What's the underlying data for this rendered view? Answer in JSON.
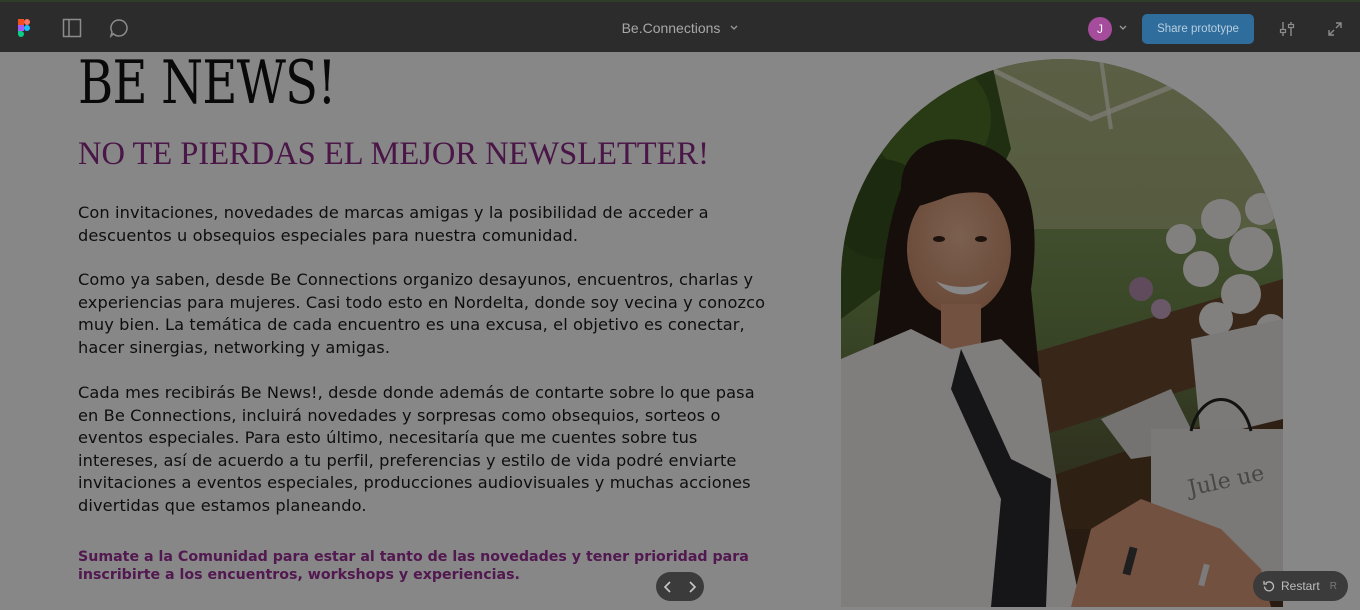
{
  "toolbar": {
    "logo_icon": "figma-logo-icon",
    "sidebar_icon": "sidebar-toggle-icon",
    "comment_icon": "comment-icon",
    "file_title": "Be.Connections",
    "avatar_initial": "J",
    "share_label": "Share prototype",
    "settings_icon": "settings-sliders-icon",
    "expand_icon": "expand-icon"
  },
  "page": {
    "headline": "BE NEWS!",
    "subheadline": "NO TE PIERDAS EL MEJOR NEWSLETTER!",
    "paragraph_1": "Con invitaciones, novedades de marcas amigas y la posibilidad de acceder a descuentos u obsequios especiales para nuestra comunidad.",
    "paragraph_2": "Como ya saben, desde Be Connections organizo desayunos, encuentros, charlas y experiencias para mujeres. Casi todo esto en Nordelta, donde soy vecina y conozco muy bien. La temática de cada encuentro es una excusa, el objetivo es conectar, hacer sinergias, networking y amigas.",
    "paragraph_3": "Cada mes recibirás Be News!, desde donde además de contarte sobre lo que pasa en Be Connections, incluirá novedades y sorpresas como obsequios, sorteos o eventos especiales. Para esto último, necesitaría que me cuentes sobre tus intereses, así de acuerdo a tu perfil, preferencias y estilo de vida podré enviarte invitaciones a eventos especiales, producciones audiovisuales y muchas acciones divertidas que estamos planeando.",
    "cta": "Sumate a la Comunidad para estar al tanto de las novedades y tener prioridad para inscribirte a los encuentros, workshops y experiencias.",
    "photo_bag_text": "Jule   ue"
  },
  "prototype_nav": {
    "prev_icon": "chevron-left-icon",
    "next_icon": "chevron-right-icon",
    "restart_label": "Restart",
    "restart_key": "R"
  },
  "colors": {
    "toolbar_bg": "#2c2c2c",
    "share_button": "#2f6d9c",
    "avatar": "#a64c9c",
    "accent_purple": "#8a2a86",
    "cta_purple": "#9b2e97"
  }
}
